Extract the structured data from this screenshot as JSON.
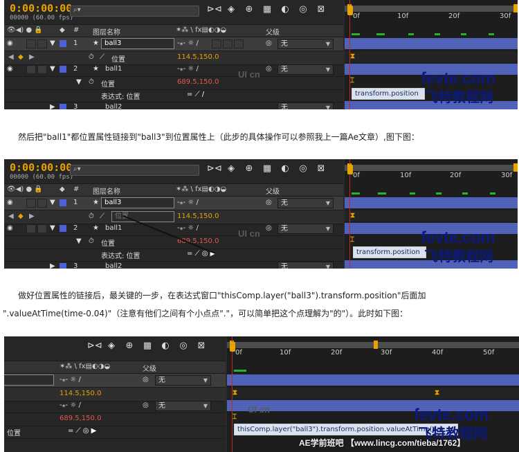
{
  "colors": {
    "timecode": "#e8a300",
    "label_blue": "#4f5fd6",
    "value_red": "#e05a4a",
    "track_blue": "#4d5fb6",
    "keyframe_green": "#27b230",
    "watermark_blue": "#0c1a7d",
    "watermark_red": "#e1261c"
  },
  "icons": {
    "search": "search-icon",
    "composition": "comp-flowchart-icon",
    "3d": "cube-icon",
    "draft": "draft-icon",
    "frame_blend": "frame-blend-icon",
    "motion_blur": "motion-blur-icon",
    "graph": "graph-editor-icon",
    "pickwhip": "pickwhip-icon"
  },
  "panel1": {
    "timecode": "0:00:00:00",
    "fps": "00000 (60.00 fps)",
    "header": {
      "layer_name": "图层名称",
      "parent": "父级"
    },
    "ruler_ticks": [
      "0f",
      "10f",
      "20f",
      "30f"
    ],
    "rows": [
      {
        "num": "1",
        "name": "ball3",
        "parent": "无"
      },
      {
        "prop": "位置",
        "value": "114.5,150.0"
      },
      {
        "num": "2",
        "name": "ball1",
        "parent": "无"
      },
      {
        "prop": "位置",
        "value": "689.5,150.0"
      },
      {
        "expr_label": "表达式: 位置"
      },
      {
        "num": "3",
        "name": "ball2",
        "parent": "无"
      }
    ],
    "expression": "transform.position"
  },
  "para1": "然后把\"ball1\"都位置属性链接到\"ball3\"到位置属性上（此步的具体操作可以参照我上一篇Ae文章）,图下图：",
  "panel2": {
    "timecode": "0:00:00:00",
    "fps": "00000 (60.00 fps)",
    "header": {
      "layer_name": "图层名称",
      "parent": "父级"
    },
    "ruler_ticks": [
      "0f",
      "10f",
      "20f",
      "30f"
    ],
    "rows": [
      {
        "num": "1",
        "name": "ball3",
        "parent": "无"
      },
      {
        "prop": "位置",
        "value": "114.5,150.0"
      },
      {
        "num": "2",
        "name": "ball1",
        "parent": "无"
      },
      {
        "prop": "位置",
        "value": "689.5,150.0"
      },
      {
        "expr_label": "表达式: 位置"
      },
      {
        "num": "3",
        "name": "ball2",
        "parent": "无"
      }
    ],
    "expression": "transform.position"
  },
  "para2_line1": "做好位置属性的链接后，最关键的一步，在表达式窗口\"thisComp.layer(\"ball3\").transform.position\"后面加",
  "para2_line2": "\".valueAtTime(time-0.04)\"（注意有他们之间有个小点点\".\"，可以简单把这个点理解为\"的\"）。此时如下图：",
  "panel3": {
    "ruler_ticks": [
      "0f",
      "10f",
      "20f",
      "30f",
      "40f",
      "50f"
    ],
    "parent_label": "父级",
    "parent_values": [
      "无",
      "无"
    ],
    "values": [
      "114.5,150.0",
      "689.5,150.0"
    ],
    "prop_label": "位置",
    "expression": "thisComp.layer(\"ball3\").transform.position.valueAtTime(tim"
  },
  "watermark": {
    "site_a": "fevte",
    "site_b": ".com",
    "site_cn": "飞特教程网",
    "ui": "UI",
    "cn": "cn",
    "bottom": "AE学前班吧 【www.lincg.com/tieba/1762】"
  }
}
